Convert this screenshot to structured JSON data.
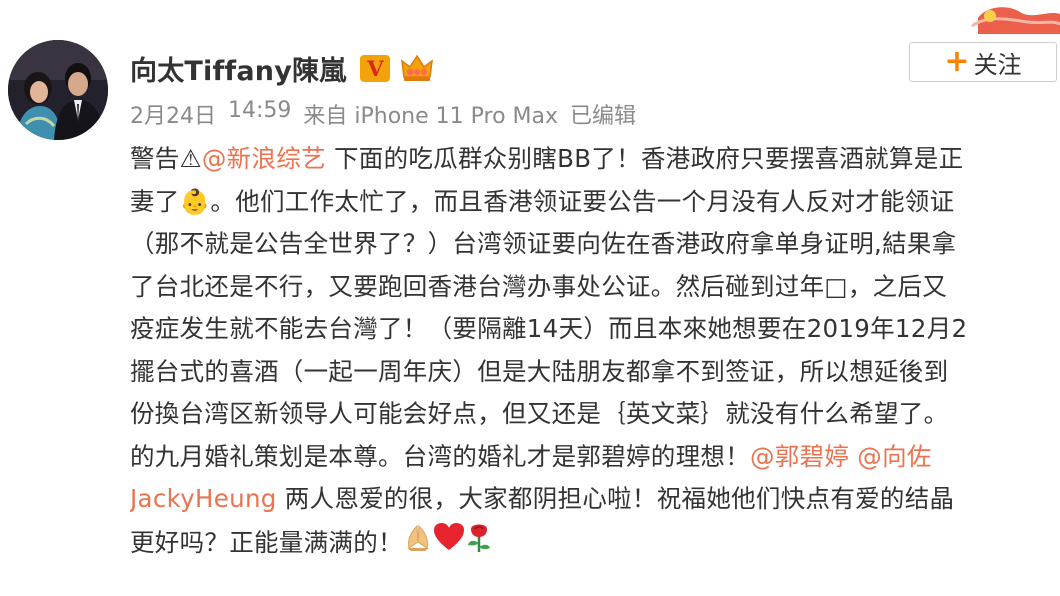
{
  "header": {
    "username": "向太Tiffany陳嵐",
    "verified_badge": "V",
    "crown_icon": "crown-icon",
    "follow_plus": "+",
    "follow_label": "关注"
  },
  "meta": {
    "date": "2月24日",
    "time": "14:59",
    "source": "来自 iPhone 11 Pro Max",
    "edited": "已编辑"
  },
  "post": {
    "lines": [
      [
        {
          "text": "警告⚠",
          "type": "text"
        },
        {
          "text": "@新浪综艺",
          "type": "mention"
        },
        {
          "text": " 下面的吃瓜群众别瞎BB了！香港政府只要摆喜酒就算是正",
          "type": "text"
        }
      ],
      [
        {
          "text": "妻了👶。他们工作太忙了，而且香港领证要公告一个月没有人反对才能领证",
          "type": "text"
        }
      ],
      [
        {
          "text": "（那不就是公告全世界了？）台湾领证要向佐在香港政府拿单身证明,結果拿",
          "type": "text"
        }
      ],
      [
        {
          "text": "了台北还是不行，又要跑回香港台灣办事处公证。然后碰到过年□，之后又",
          "type": "text"
        }
      ],
      [
        {
          "text": "疫症发生就不能去台灣了！（要隔離14天）而且本來她想要在2019年12月2",
          "type": "text"
        }
      ],
      [
        {
          "text": "擺台式的喜酒（一起一周年庆）但是大陆朋友都拿不到签证，所以想延後到",
          "type": "text"
        }
      ],
      [
        {
          "text": "份換台湾区新领导人可能会好点，但又还是｛英文菜｝就没有什么希望了。",
          "type": "text"
        }
      ],
      [
        {
          "text": "的九月婚礼策划是本尊。台湾的婚礼才是郭碧婷的理想！",
          "type": "text"
        },
        {
          "text": "@郭碧婷",
          "type": "mention"
        },
        {
          "text": " ",
          "type": "text"
        },
        {
          "text": "@向佐",
          "type": "mention"
        }
      ],
      [
        {
          "text": "JackyHeung",
          "type": "mention"
        },
        {
          "text": " 两人恩爱的很，大家都阴担心啦！祝福她他们快点有爱的结晶",
          "type": "text"
        }
      ],
      [
        {
          "text": "更好吗？正能量满满的！",
          "type": "text"
        }
      ]
    ],
    "trailing_emojis": [
      "praying-hands-icon",
      "heart-icon",
      "rose-icon"
    ]
  },
  "colors": {
    "mention": "#eb7350",
    "follow_plus": "#ff8200",
    "meta": "#8a8a8a",
    "text": "#333333",
    "vip_bg": "#f4a20c",
    "vip_fg": "#d9261c"
  }
}
